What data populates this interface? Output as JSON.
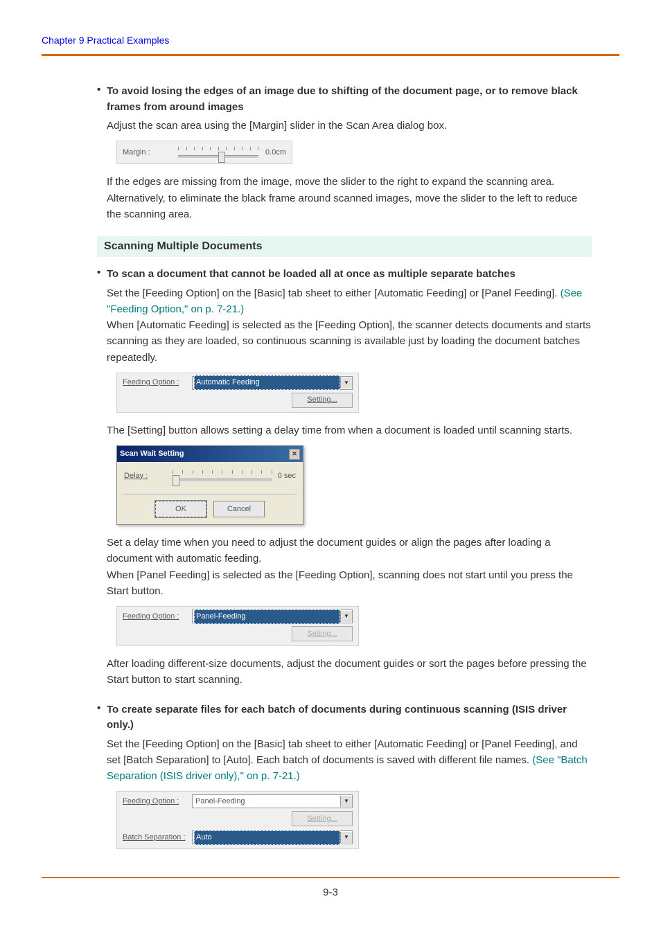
{
  "header": {
    "chapter": "Chapter 9    Practical Examples"
  },
  "body": {
    "item1": {
      "title": "To avoid losing the edges of an image due to shifting of the document page, or to remove black frames from around images",
      "text1": "Adjust the scan area using the [Margin] slider in the Scan Area dialog box.",
      "margin_label": "Margin :",
      "margin_value": "0.0cm",
      "text2": "If the edges are missing from the image, move the slider to the right to expand the scanning area. Alternatively, to eliminate the black frame around scanned images, move the slider to the left to reduce the scanning area."
    },
    "section_header": "Scanning Multiple Documents",
    "item2": {
      "title": "To scan a document that cannot be loaded all at once as multiple separate batches",
      "text1a": "Set the [Feeding Option] on the [Basic] tab sheet to either [Automatic Feeding] or [Panel Feeding]. ",
      "link1": "(See \"Feeding Option,\" on p. 7-21.)",
      "text1b": "When [Automatic Feeding] is selected as the [Feeding Option], the scanner detects documents and starts scanning as they are loaded, so continuous scanning is available just by loading the document batches repeatedly.",
      "feed1_label": "Feeding Option :",
      "feed1_value": "Automatic Feeding",
      "feed1_btn": "Setting...",
      "text2": "The [Setting] button allows setting a delay time from when a document is loaded until scanning starts.",
      "dlg_title": "Scan Wait Setting",
      "dlg_delay_label": "Delay :",
      "dlg_delay_value": "0 sec",
      "dlg_ok": "OK",
      "dlg_cancel": "Cancel",
      "text3": "Set a delay time when you need to adjust the document guides or align the pages after loading a document with automatic feeding.",
      "text4": "When [Panel Feeding] is selected as the [Feeding Option], scanning does not start until you press the Start button.",
      "feed2_label": "Feeding Option :",
      "feed2_value": "Panel-Feeding",
      "feed2_btn": "Setting...",
      "text5": "After loading different-size documents, adjust the document guides or sort the pages before pressing the Start button to start scanning."
    },
    "item3": {
      "title": "To create separate files for each batch of documents during continuous scanning (ISIS driver only.)",
      "text1a": "Set the [Feeding Option] on the [Basic] tab sheet to either [Automatic Feeding] or [Panel Feeding], and set [Batch Separation] to [Auto]. Each batch of documents is saved with different file names. ",
      "link1": "(See \"Batch Separation (ISIS driver only),\" on p. 7-21.)",
      "feed_label": "Feeding Option :",
      "feed_value": "Panel-Feeding",
      "feed_btn": "Setting...",
      "batch_label": "Batch Separation :",
      "batch_value": "Auto"
    }
  },
  "footer": {
    "page_number": "9-3"
  }
}
